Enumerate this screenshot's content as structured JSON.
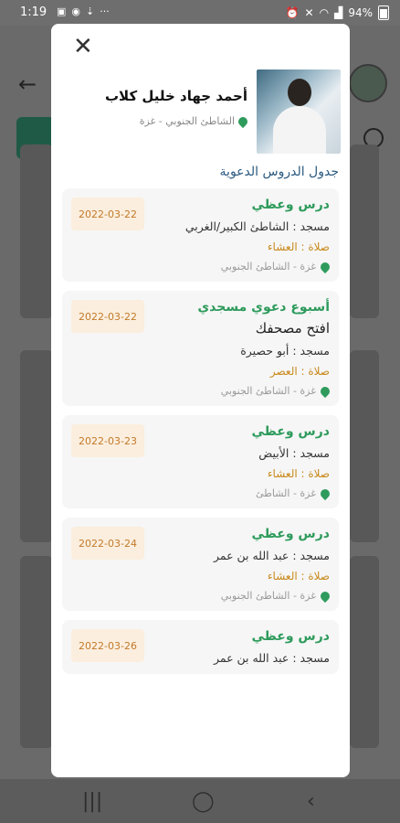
{
  "status_bar": {
    "time": "1:19",
    "battery": "94%"
  },
  "colors": {
    "accent_green": "#2e9b5c",
    "date_text": "#c27a2a",
    "date_bg": "#fbeede",
    "prayer_text": "#c98a1c",
    "section_title": "#2b5a80"
  },
  "modal": {
    "profile": {
      "name": "أحمد جهاد خليل كلاب",
      "location": "الشاطئ الجنوبي - غزة"
    },
    "section_title": "جدول الدروس الدعوية",
    "items": [
      {
        "title": "درس وعظي",
        "subtitle": "",
        "mosque": "مسجد : الشاطئ الكبير/الغربي",
        "prayer": "صلاة : العشاء",
        "location": "غزة - الشاطئ الجنوبي",
        "date": "2022-03-22"
      },
      {
        "title": "أسبوع دعوي مسجدي",
        "subtitle": "افتح مصحفك",
        "mosque": "مسجد : أبو حصيرة",
        "prayer": "صلاة : العصر",
        "location": "غزة - الشاطئ الجنوبي",
        "date": "2022-03-22"
      },
      {
        "title": "درس وعظي",
        "subtitle": "",
        "mosque": "مسجد : الأبيض",
        "prayer": "صلاة : العشاء",
        "location": "غزة - الشاطئ",
        "date": "2022-03-23"
      },
      {
        "title": "درس وعظي",
        "subtitle": "",
        "mosque": "مسجد : عبد الله بن عمر",
        "prayer": "صلاة : العشاء",
        "location": "غزة - الشاطئ الجنوبي",
        "date": "2022-03-24"
      },
      {
        "title": "درس وعظي",
        "subtitle": "",
        "mosque": "مسجد : عبد الله بن عمر",
        "prayer": "",
        "location": "",
        "date": "2022-03-26"
      }
    ]
  }
}
